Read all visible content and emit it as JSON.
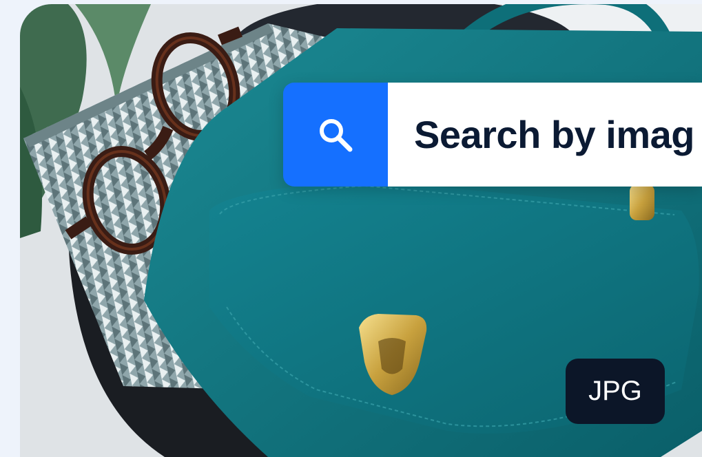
{
  "search": {
    "label": "Search by imag",
    "icon": "search-icon"
  },
  "badge": {
    "label": "JPG"
  },
  "colors": {
    "accent": "#1570ff",
    "badge_bg": "#0c1628",
    "bag": "#0f7580",
    "page_bg": "#eef3fb"
  },
  "image": {
    "subject": "teal leather handbag with gold clasp beside tortoiseshell glasses on a patterned book"
  }
}
